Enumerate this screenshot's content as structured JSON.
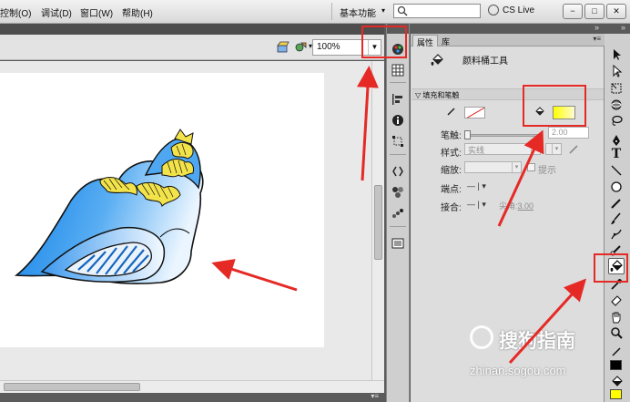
{
  "menubar": {
    "items": [
      "控制(O)",
      "调试(D)",
      "窗口(W)",
      "帮助(H)"
    ],
    "workspace": "基本功能",
    "search_placeholder": "",
    "cs_live": "CS Live",
    "window_buttons": [
      "−",
      "□",
      "✕"
    ]
  },
  "editbar": {
    "zoom": "100%"
  },
  "stage": {
    "artwork": "conch-shell-drawing",
    "colors": {
      "shell_blue": "#1e90ff",
      "stripe_yellow": "#f3e34a",
      "stage_bg": "#ffffff"
    }
  },
  "properties": {
    "tabs": [
      "属性",
      "库"
    ],
    "tool_name": "颜料桶工具",
    "section_title": "填充和笔触",
    "stroke_label": "笔触:",
    "stroke_value": "2.00",
    "style_label": "样式:",
    "style_value": "实线",
    "scale_label": "缩放:",
    "scale_value": "",
    "hint_label": "提示",
    "cap_label": "端点:",
    "join_label": "接合:",
    "miter_label": "尖角:",
    "miter_value": "3.00",
    "fill_color": "#ffff00"
  },
  "watermark": {
    "brand": "搜狗指南",
    "url": "zhinan.sogou.com"
  },
  "annotations": {
    "highlight_color": "#e52a26"
  }
}
